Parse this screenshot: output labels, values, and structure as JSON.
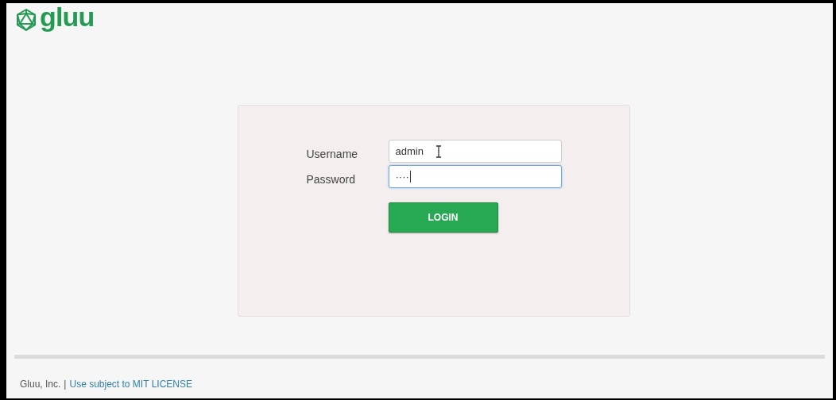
{
  "logo": {
    "text": "gluu"
  },
  "form": {
    "fields": [
      {
        "label": "Username",
        "value": "admin",
        "focused": false
      },
      {
        "label": "Password",
        "value": "····",
        "focused": true
      }
    ],
    "button": "LOGIN"
  },
  "footer": {
    "company": "Gluu, Inc.",
    "separator": "|",
    "link": "Use subject to MIT LICENSE"
  }
}
